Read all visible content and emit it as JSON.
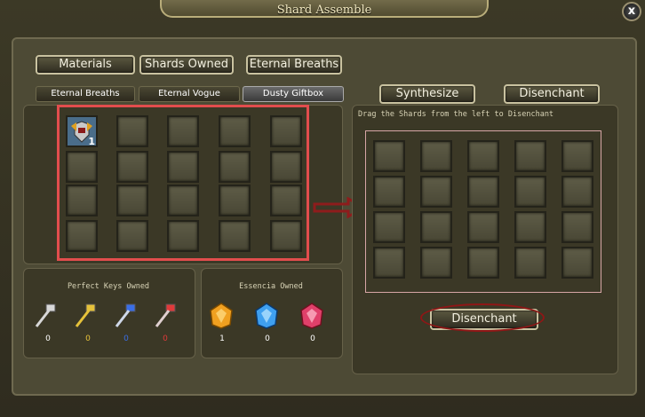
{
  "window": {
    "title": "Shard Assemble",
    "close_symbol": "x"
  },
  "top_buttons": [
    "Materials",
    "Shards Owned",
    "Eternal Breaths"
  ],
  "tabs": [
    {
      "label": "Eternal Breaths",
      "active": false
    },
    {
      "label": "Eternal Vogue",
      "active": false
    },
    {
      "label": "Dusty Giftbox",
      "active": true
    }
  ],
  "action_buttons": {
    "synthesize": "Synthesize",
    "disenchant": "Disenchant"
  },
  "inventory": {
    "first_item_icon": "armor-icon",
    "first_item_count": "1"
  },
  "disenchant_panel": {
    "instruction": "Drag the Shards from the left to Disenchant",
    "button": "Disenchant"
  },
  "keys": {
    "title": "Perfect Keys Owned",
    "items": [
      {
        "icon": "silver-key-icon",
        "count": "0",
        "color": "#d8d8d8"
      },
      {
        "icon": "gold-key-icon",
        "count": "0",
        "color": "#e6c23a"
      },
      {
        "icon": "blue-key-icon",
        "count": "0",
        "color": "#3a6ee6"
      },
      {
        "icon": "red-key-icon",
        "count": "0",
        "color": "#e03a3a"
      }
    ]
  },
  "essence": {
    "title": "Essencia Owned",
    "items": [
      {
        "icon": "orange-essence-icon",
        "count": "1",
        "color": "#f0a020"
      },
      {
        "icon": "blue-essence-icon",
        "count": "0",
        "color": "#3fa0f0"
      },
      {
        "icon": "pink-essence-icon",
        "count": "0",
        "color": "#e0406a"
      }
    ]
  },
  "colors": {
    "highlight_red": "#e24d4d",
    "ellipse_red": "#8f1616",
    "arrow_red": "#8e1c1c"
  }
}
